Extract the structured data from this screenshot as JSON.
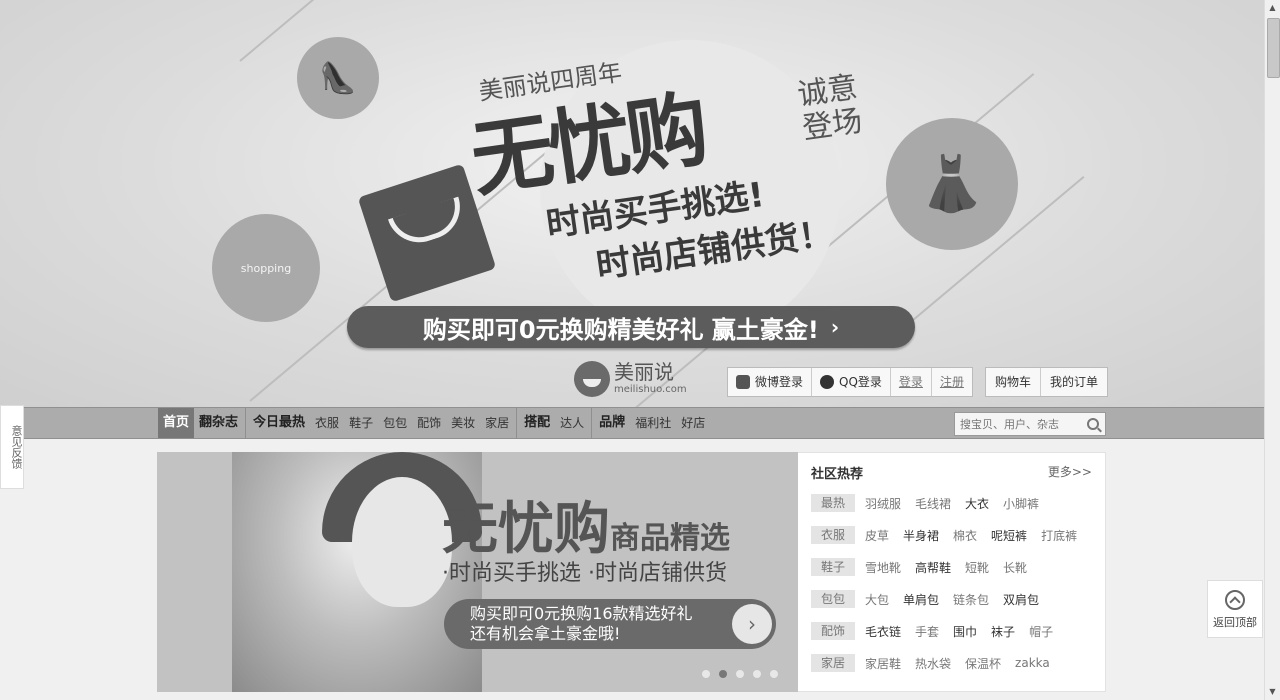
{
  "banner": {
    "subtitle": "美丽说四周年",
    "main_title": "无忧购",
    "side_text": "诚意登场",
    "line1": "时尚买手挑选!",
    "line2": "时尚店铺供货！",
    "cta": "购买即可0元换购精美好礼 赢土豪金!",
    "shopping_label": "shopping"
  },
  "logo": {
    "name": "美丽说",
    "domain": "meilishuo.com"
  },
  "auth": {
    "weibo": "微博登录",
    "qq": "QQ登录",
    "login": "登录",
    "register": "注册"
  },
  "cart": {
    "cart": "购物车",
    "orders": "我的订单"
  },
  "nav": {
    "items": [
      "首页",
      "翻杂志",
      "今日最热",
      "衣服",
      "鞋子",
      "包包",
      "配饰",
      "美妆",
      "家居",
      "搭配",
      "达人",
      "品牌",
      "福利社",
      "好店"
    ]
  },
  "search": {
    "placeholder": "搜宝贝、用户、杂志"
  },
  "feedback": {
    "label": "意见反馈"
  },
  "carousel": {
    "title": "无忧购",
    "title_suffix": "商品精选",
    "subtitle": "·时尚买手挑选  ·时尚店铺供货",
    "cta_line1": "购买即可0元换购16款精选好礼",
    "cta_line2": "还有机会拿土豪金哦!",
    "slide_count": 5,
    "active_slide": 2
  },
  "hot": {
    "title": "社区热荐",
    "more": "更多>>",
    "rows": [
      {
        "tag": "最热",
        "keywords": [
          "羽绒服",
          "毛线裙",
          "大衣",
          "小脚裤"
        ]
      },
      {
        "tag": "衣服",
        "keywords": [
          "皮草",
          "半身裙",
          "棉衣",
          "呢短裤",
          "打底裤"
        ]
      },
      {
        "tag": "鞋子",
        "keywords": [
          "雪地靴",
          "高帮鞋",
          "短靴",
          "长靴"
        ]
      },
      {
        "tag": "包包",
        "keywords": [
          "大包",
          "单肩包",
          "链条包",
          "双肩包"
        ]
      },
      {
        "tag": "配饰",
        "keywords": [
          "毛衣链",
          "手套",
          "围巾",
          "袜子",
          "帽子"
        ]
      },
      {
        "tag": "家居",
        "keywords": [
          "家居鞋",
          "热水袋",
          "保温杯",
          "zakka"
        ]
      }
    ]
  },
  "backtop": {
    "label": "返回顶部"
  }
}
